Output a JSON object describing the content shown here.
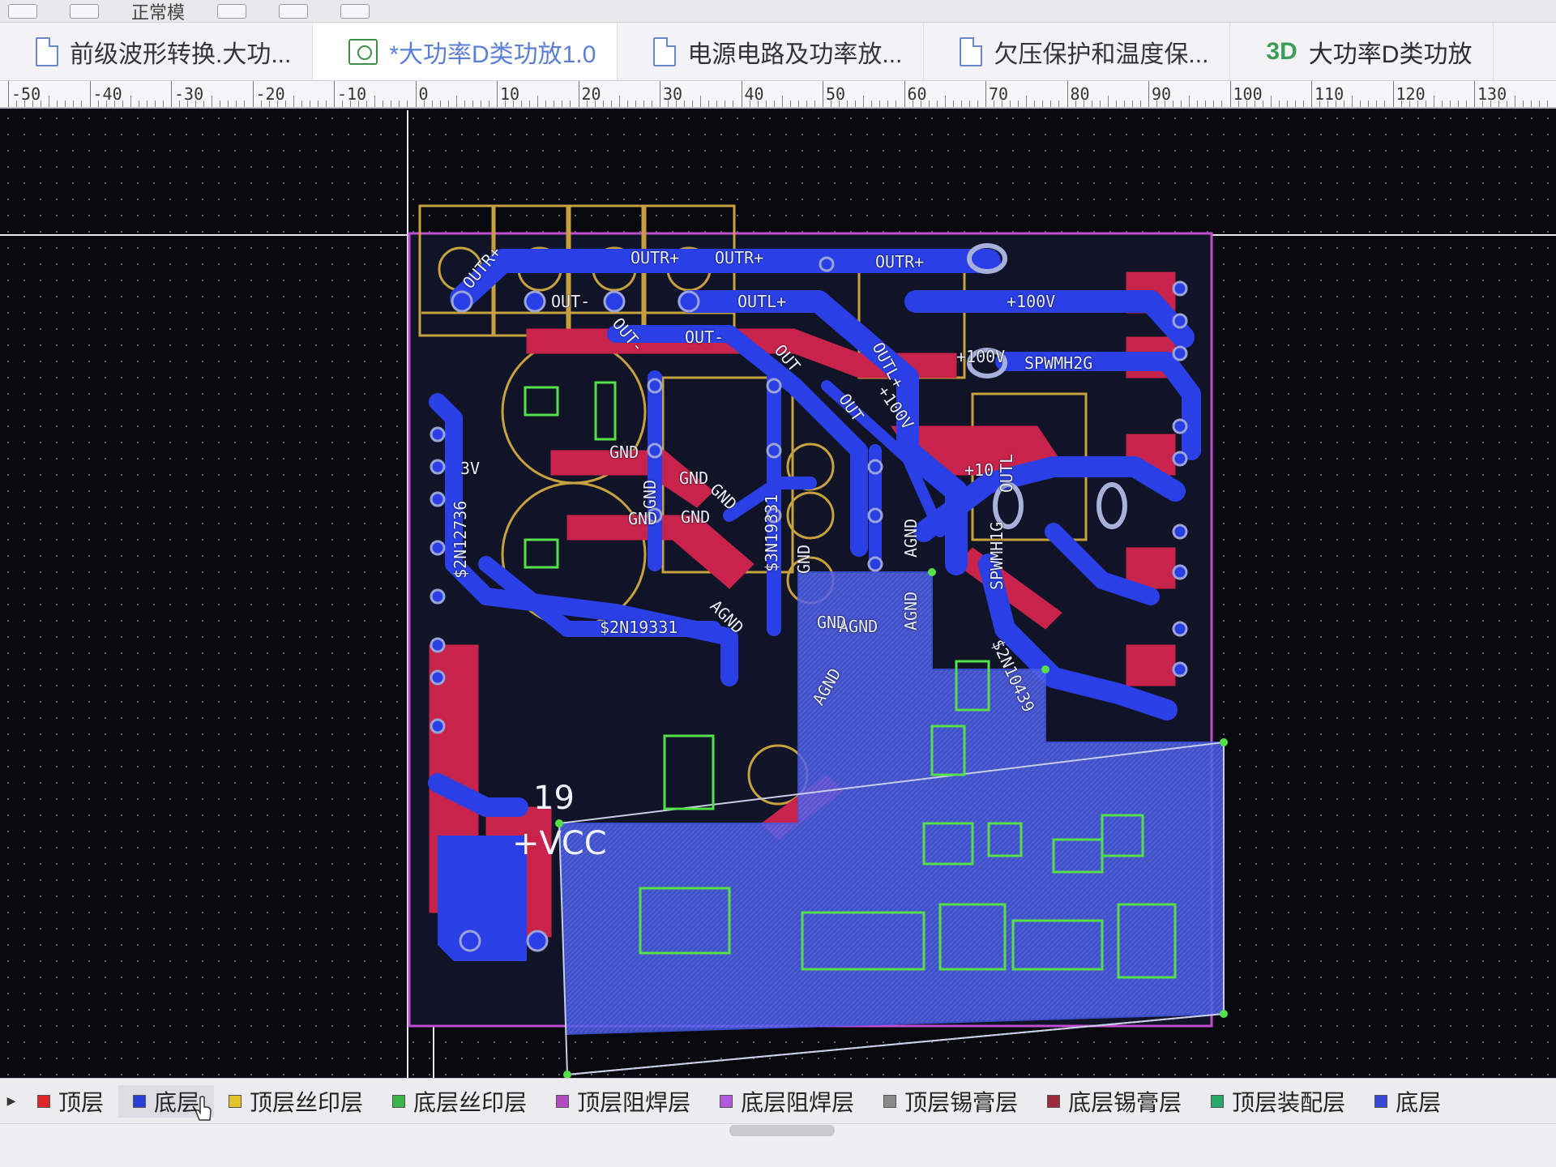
{
  "toolbar": {
    "label": "正常模"
  },
  "tabs": [
    {
      "label": "前级波形转换.大功...",
      "icon": "document-icon",
      "active": false
    },
    {
      "label": "*大功率D类功放1.0",
      "icon": "pcb-icon",
      "active": true
    },
    {
      "label": "电源电路及功率放...",
      "icon": "document-icon",
      "active": false
    },
    {
      "label": "欠压保护和温度保...",
      "icon": "document-icon",
      "active": false
    },
    {
      "label": "大功率D类功放",
      "icon_text": "3D",
      "active": false
    }
  ],
  "ruler": {
    "labels": [
      "-50",
      "-40",
      "-30",
      "-20",
      "-10",
      "0",
      "10",
      "20",
      "30",
      "40",
      "50",
      "60",
      "70",
      "80",
      "90",
      "100",
      "110",
      "120",
      "130"
    ]
  },
  "pcb": {
    "net_labels": [
      "OUTR+",
      "OUTR+",
      "OUTR+",
      "OUTR+",
      "OUT-",
      "OUTL+",
      "OUT-",
      "OUT-",
      "OUT",
      "OUT",
      "OUTL+",
      "+100V",
      "+100V",
      "+100V",
      "SPWMH2G",
      "GND",
      "GND",
      "GND",
      "GND",
      "GND",
      "GND",
      "GND",
      "$2N12736",
      "$2N19331",
      "$3N19331",
      "$2N10439",
      "AGND",
      "AGND",
      "AGND",
      "AGND",
      "AGND",
      "SPWMH1G",
      "OUTL",
      "+10",
      "GND",
      "3V"
    ],
    "designator": "19",
    "power_net": "+VCC"
  },
  "layers": [
    {
      "label": "顶层",
      "color": "#e0242c",
      "active": false
    },
    {
      "label": "底层",
      "color": "#2a3fd6",
      "active": true
    },
    {
      "label": "顶层丝印层",
      "color": "#e6c42a",
      "active": false
    },
    {
      "label": "底层丝印层",
      "color": "#3ab54a",
      "active": false
    },
    {
      "label": "顶层阻焊层",
      "color": "#b04cc2",
      "active": false
    },
    {
      "label": "底层阻焊层",
      "color": "#b05ae0",
      "active": false
    },
    {
      "label": "顶层锡膏层",
      "color": "#8a8a8a",
      "active": false
    },
    {
      "label": "底层锡膏层",
      "color": "#9c2a3a",
      "active": false
    },
    {
      "label": "顶层装配层",
      "color": "#2aa86a",
      "active": false
    },
    {
      "label": "底层",
      "color": "#3a48d6",
      "active": false
    }
  ]
}
